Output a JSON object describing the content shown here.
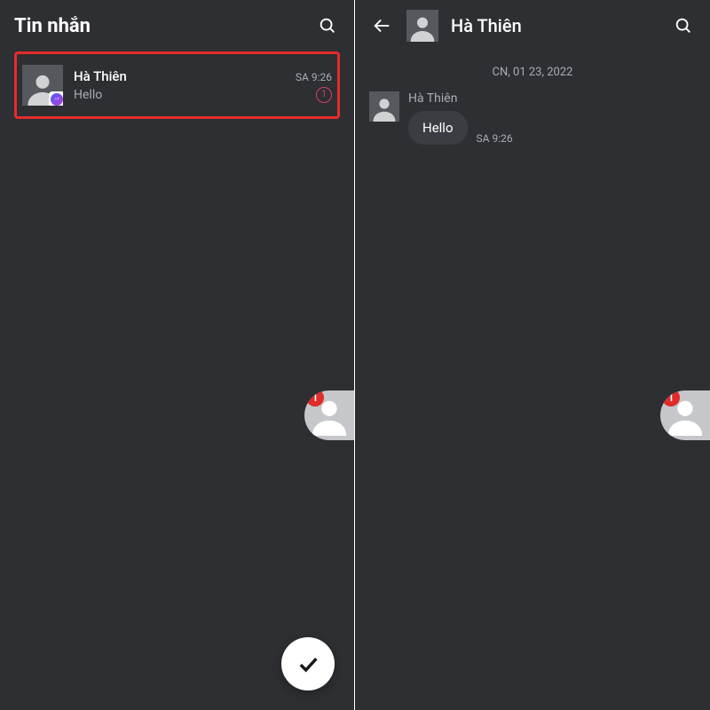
{
  "left": {
    "title": "Tin nhắn",
    "conversations": [
      {
        "name": "Hà Thiên",
        "preview": "Hello",
        "time": "SA 9:26",
        "unread": "1"
      }
    ],
    "chathead_badge": "1"
  },
  "right": {
    "title": "Hà Thiên",
    "date": "CN, 01 23, 2022",
    "sender": "Hà Thiên",
    "message": "Hello",
    "message_time": "SA 9:26",
    "chathead_badge": "1"
  }
}
